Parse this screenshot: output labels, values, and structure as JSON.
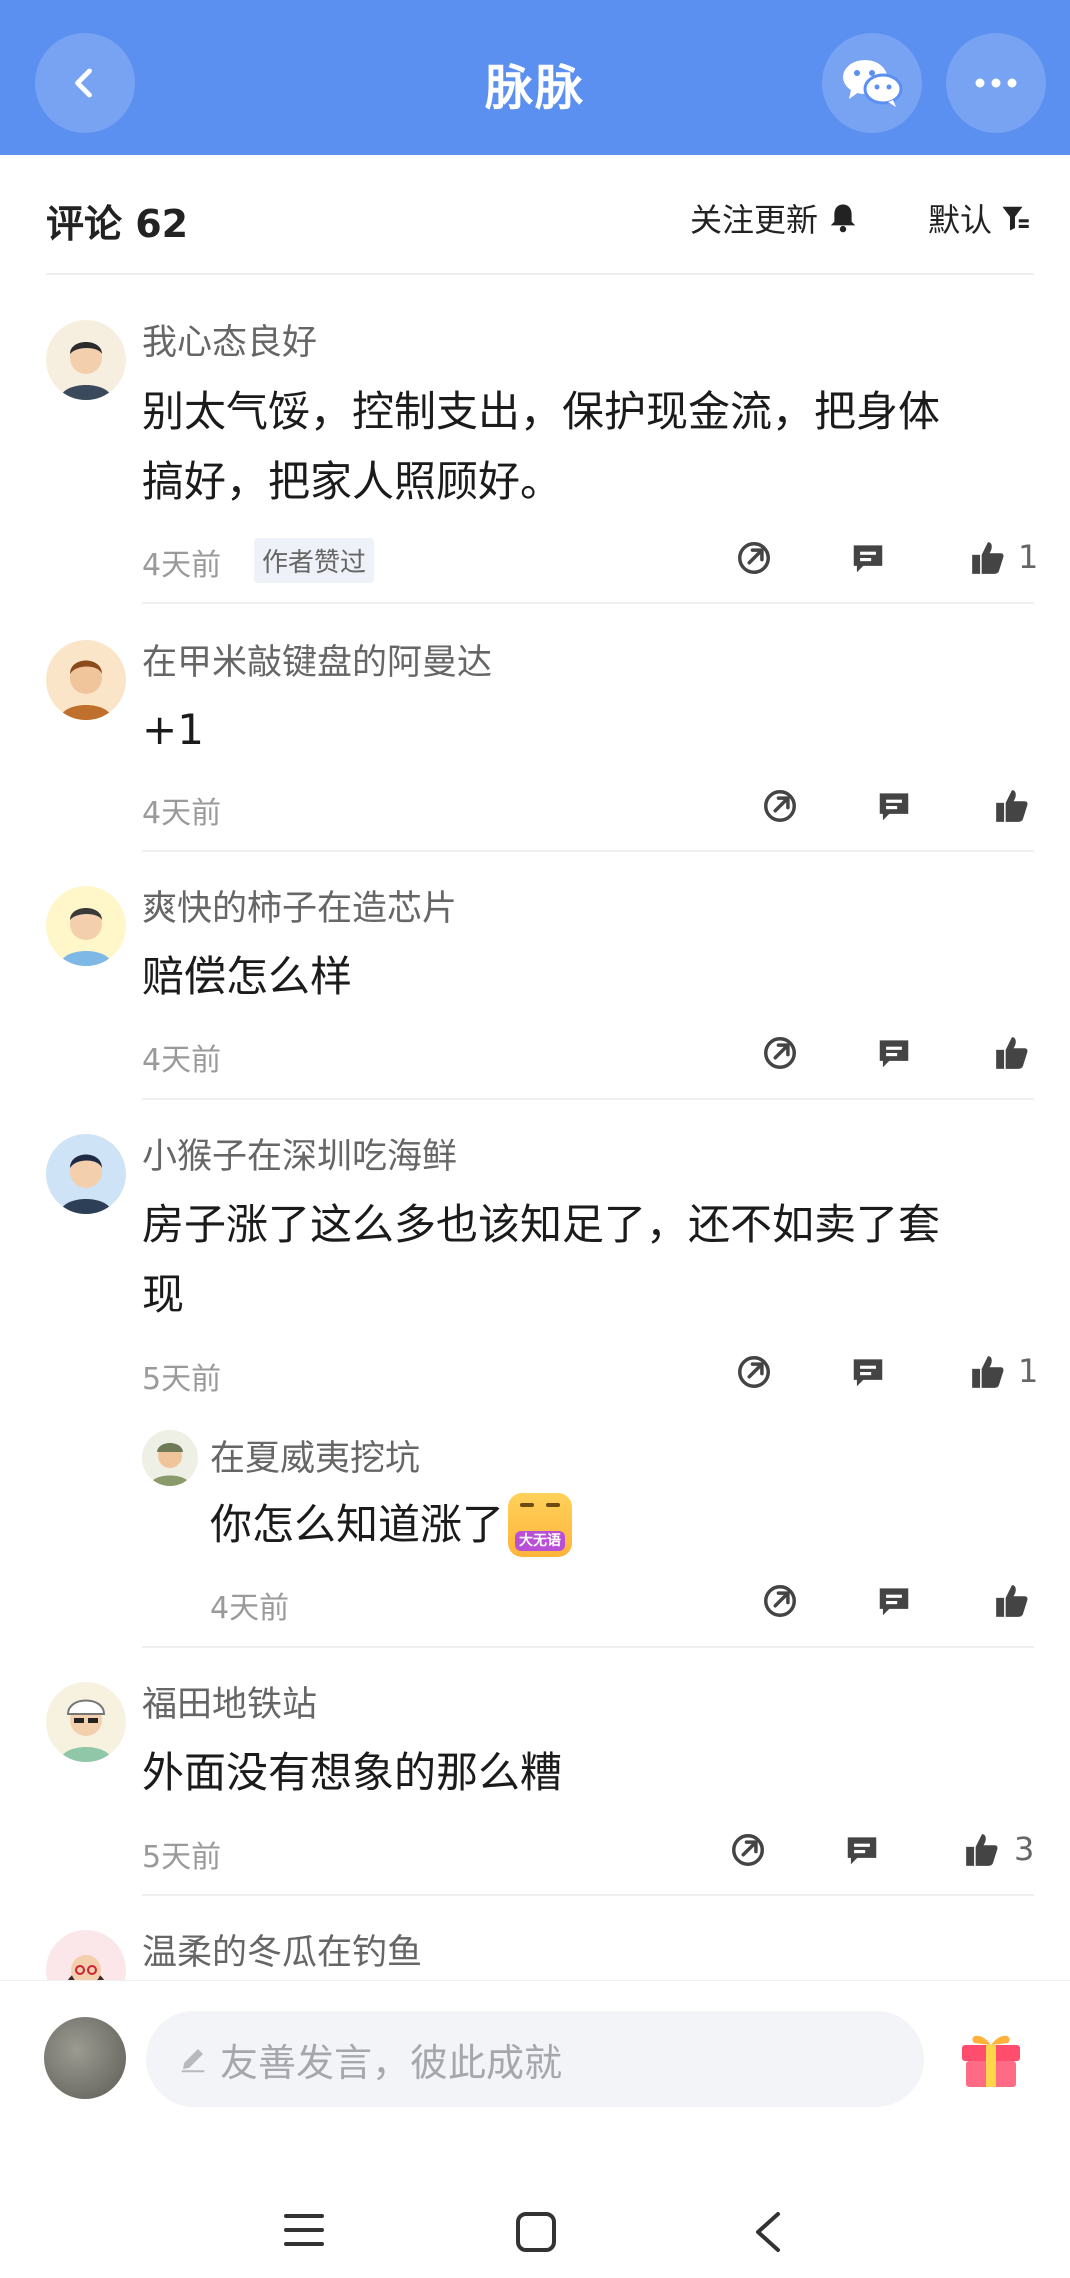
{
  "header": {
    "title": "脉脉",
    "back_icon": "chevron-left-icon",
    "wechat_icon": "wechat-icon",
    "more_icon": "more-dots-icon",
    "color": "#5b8ff0"
  },
  "comments_header": {
    "title": "评论 62",
    "follow_label": "关注更新",
    "sort_label": "默认"
  },
  "comments": [
    {
      "author": "我心态良好",
      "text_lines": [
        "别太气馁，控制支出，保护现金流，把身体",
        "搞好，把家人照顾好。"
      ],
      "time": "4天前",
      "tag": "作者赞过",
      "likes": "1"
    },
    {
      "author": "在甲米敲键盘的阿曼达",
      "text_lines": [
        "+1"
      ],
      "time": "4天前",
      "likes": ""
    },
    {
      "author": "爽快的柿子在造芯片",
      "text_lines": [
        "赔偿怎么样"
      ],
      "time": "4天前",
      "likes": ""
    },
    {
      "author": "小猴子在深圳吃海鲜",
      "text_lines": [
        "房子涨了这么多也该知足了，还不如卖了套",
        "现"
      ],
      "time": "5天前",
      "likes": "1",
      "reply": {
        "author": "在夏威夷挖坑",
        "text": "你怎么知道涨了",
        "emoji_label": "大无语",
        "time": "4天前",
        "likes": ""
      }
    },
    {
      "author": "福田地铁站",
      "text_lines": [
        "外面没有想象的那么糟"
      ],
      "time": "5天前",
      "likes": "3"
    },
    {
      "author": "温柔的冬瓜在钓鱼",
      "text_lines": [],
      "time": "",
      "likes": ""
    }
  ],
  "bottom": {
    "placeholder": "友善发言，彼此成就",
    "gift_icon": "gift-icon",
    "pen_icon": "pen-icon"
  },
  "system_nav": [
    "menu-icon",
    "home-square-icon",
    "back-triangle-icon"
  ]
}
